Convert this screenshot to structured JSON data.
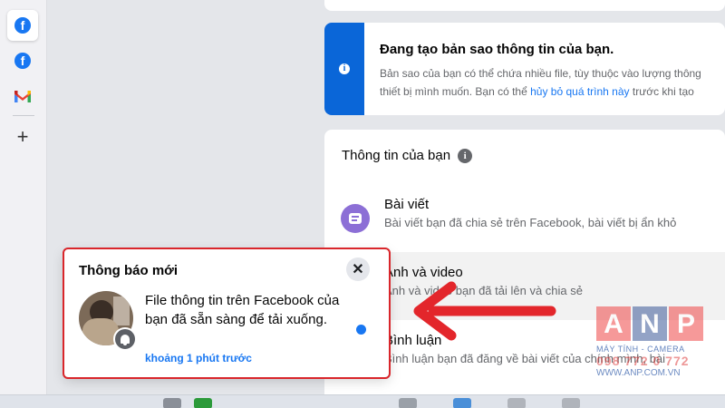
{
  "sidebar": {
    "items": [
      {
        "icon": "facebook-icon",
        "label": "f"
      },
      {
        "icon": "facebook-icon",
        "label": "f"
      },
      {
        "icon": "gmail-icon",
        "label": "M"
      }
    ],
    "add_label": "+"
  },
  "progress_card": {
    "title": "Đang tạo bản sao thông tin của bạn.",
    "body_line1": "Bản sao của bạn có thể chứa nhiều file, tùy thuộc vào lượng thông",
    "body_line2_prefix": "thiết bị mình muốn. Bạn có thể ",
    "body_link": "hủy bỏ quá trình này",
    "body_line2_suffix": " trước khi tạo"
  },
  "info_card": {
    "header": "Thông tin của bạn",
    "rows": [
      {
        "title": "Bài viết",
        "subtitle": "Bài viết bạn đã chia sẻ trên Facebook, bài viết bị ẩn khỏ"
      },
      {
        "title": "Ảnh và video",
        "subtitle": "Ảnh và video bạn đã tải lên và chia sẻ"
      },
      {
        "title": "Bình luận",
        "subtitle": "Bình luận bạn đã đăng về bài viết của chính mình, bài"
      }
    ]
  },
  "notification": {
    "title": "Thông báo mới",
    "close_label": "✕",
    "message": "File thông tin trên Facebook của bạn đã sẵn sàng để tải xuống.",
    "time": "khoảng 1 phút trước"
  },
  "watermark": {
    "letters": [
      "A",
      "N",
      "P"
    ],
    "tagline": "MÁY TÍNH - CAMERA",
    "phone": "098 772 0 772",
    "url": "WWW.ANP.COM.VN"
  },
  "colors": {
    "facebook_blue": "#1877f2",
    "highlight_red": "#d9262b",
    "info_blue": "#0a66d8",
    "post_purple": "#8c6fd6"
  }
}
